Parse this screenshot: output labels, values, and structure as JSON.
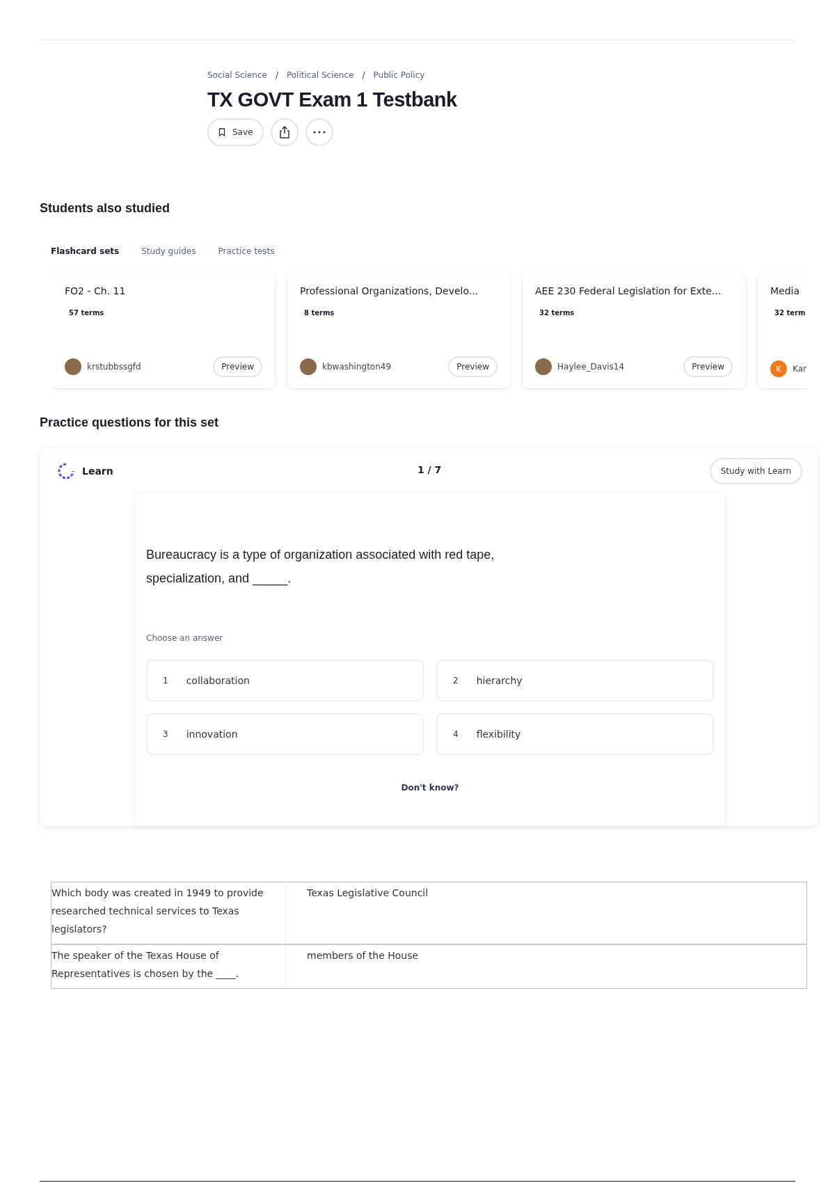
{
  "breadcrumbs": [
    "Social Science",
    "Political Science",
    "Public Policy"
  ],
  "breadcrumb_separator": "/",
  "title": "TX GOVT Exam 1 Testbank",
  "actions": {
    "save": "Save"
  },
  "also_studied": {
    "heading": "Students also studied",
    "tabs": [
      {
        "label": "Flashcard sets",
        "selected": true
      },
      {
        "label": "Study guides",
        "selected": false
      },
      {
        "label": "Practice tests",
        "selected": false
      }
    ],
    "cards": [
      {
        "title": "FO2 - Ch. 11",
        "terms": "57 terms",
        "author": "krstubbssgfd",
        "preview": "Preview"
      },
      {
        "title": "Professional Organizations, Develo...",
        "terms": "8 terms",
        "author": "kbwashington49",
        "preview": "Preview"
      },
      {
        "title": "AEE 230 Federal Legislation for Exte...",
        "terms": "32 terms",
        "author": "Haylee_Davis14",
        "preview": "Preview"
      },
      {
        "title": "Media",
        "terms": "32 term",
        "author": "Kar",
        "initial": "K"
      }
    ]
  },
  "practice": {
    "heading": "Practice questions for this set",
    "mode": "Learn",
    "progress": "1 / 7",
    "study_button": "Study with Learn",
    "question": "Bureaucracy is a type of organization associated with red tape, specialization, and _____.",
    "choose_label": "Choose an answer",
    "options": [
      {
        "number": "1",
        "text": "collaboration"
      },
      {
        "number": "2",
        "text": "hierarchy"
      },
      {
        "number": "3",
        "text": "innovation"
      },
      {
        "number": "4",
        "text": "flexibility"
      }
    ],
    "dont_know": "Don't know?"
  },
  "table": {
    "rows": [
      {
        "term": "Which body was created in 1949 to provide researched technical services to Texas legislators?",
        "definition": "Texas Legislative Council"
      },
      {
        "term": "The speaker of the Texas House of Representatives is chosen by the ____.",
        "definition": "members of the House"
      }
    ]
  }
}
